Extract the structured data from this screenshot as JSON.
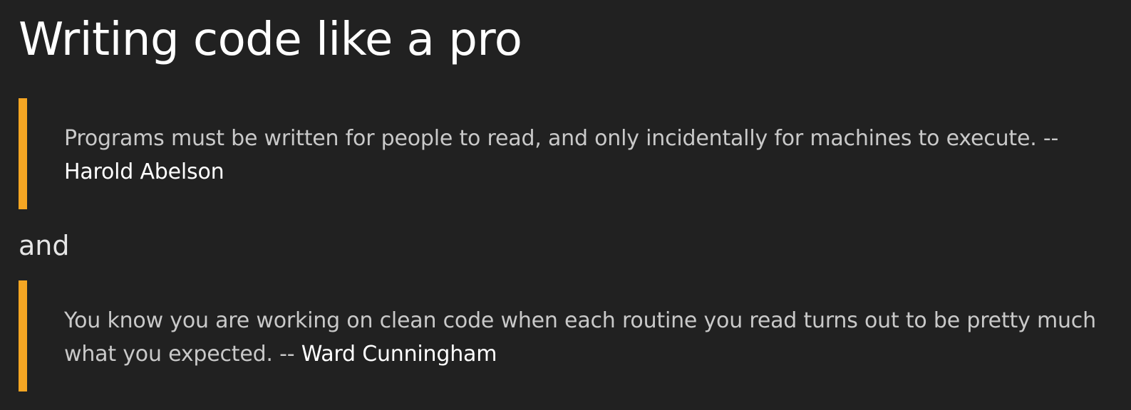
{
  "document": {
    "title": "Writing code like a pro",
    "quotes": [
      {
        "text": "Programs must be written for people to read, and only incidentally for machines to execute. --",
        "author": "Harold Abelson"
      },
      {
        "text": "You know you are working on clean code when each routine you read turns out to be pretty much what you expected. --",
        "author": "Ward Cunningham"
      }
    ],
    "connector": "and"
  },
  "colors": {
    "background": "#212121",
    "quote_bar": "#f5a623",
    "quote_text": "#c9c9c9",
    "heading": "#ffffff"
  }
}
